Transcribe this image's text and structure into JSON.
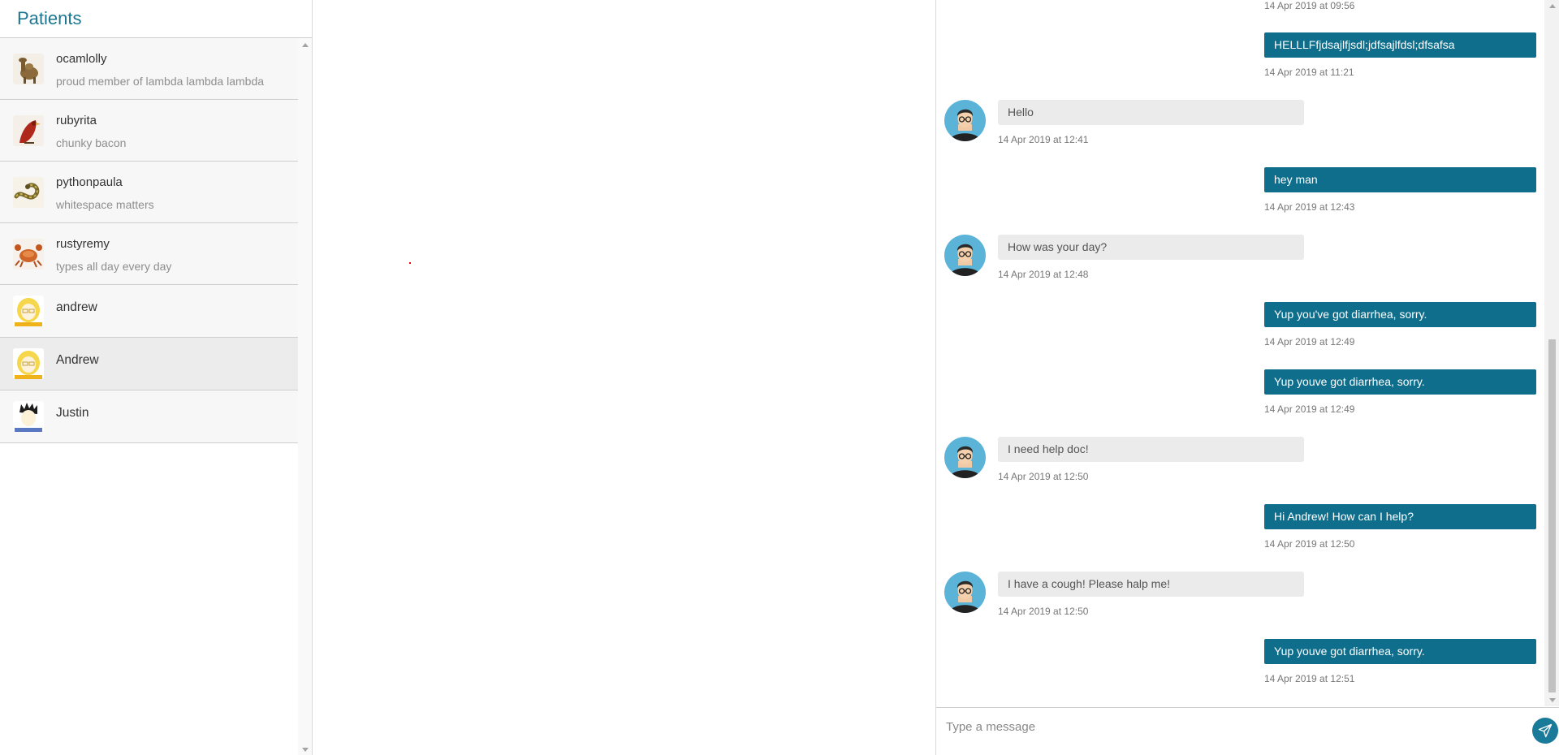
{
  "sidebar": {
    "title": "Patients",
    "patients": [
      {
        "name": "ocamlolly",
        "status": "proud member of lambda lambda lambda",
        "avatar": "camel-icon"
      },
      {
        "name": "rubyrita",
        "status": "chunky bacon",
        "avatar": "bird-icon"
      },
      {
        "name": "pythonpaula",
        "status": "whitespace matters",
        "avatar": "snake-icon"
      },
      {
        "name": "rustyremy",
        "status": "types all day every day",
        "avatar": "crab-icon"
      },
      {
        "name": "andrew",
        "status": "",
        "avatar": "blonde-user-icon"
      },
      {
        "name": "Andrew",
        "status": "",
        "avatar": "blonde-user-icon",
        "selected": true
      },
      {
        "name": "Justin",
        "status": "",
        "avatar": "dark-hair-user-icon"
      }
    ]
  },
  "chat": {
    "messages": [
      {
        "dir": "out",
        "text": "",
        "time": "14 Apr 2019 at 09:56"
      },
      {
        "dir": "out",
        "text": "HELLLFfjdsajlfjsdl;jdfsajlfdsl;dfsafsa",
        "time": "14 Apr 2019 at 11:21"
      },
      {
        "dir": "in",
        "text": "Hello",
        "time": "14 Apr 2019 at 12:41"
      },
      {
        "dir": "out",
        "text": "hey man",
        "time": "14 Apr 2019 at 12:43"
      },
      {
        "dir": "in",
        "text": "How was your day?",
        "time": "14 Apr 2019 at 12:48"
      },
      {
        "dir": "out",
        "text": "Yup you've got diarrhea, sorry.",
        "time": "14 Apr 2019 at 12:49"
      },
      {
        "dir": "out",
        "text": "Yup youve got diarrhea, sorry.",
        "time": "14 Apr 2019 at 12:49"
      },
      {
        "dir": "in",
        "text": "I need help doc!",
        "time": "14 Apr 2019 at 12:50"
      },
      {
        "dir": "out",
        "text": "Hi Andrew! How can I help?",
        "time": "14 Apr 2019 at 12:50"
      },
      {
        "dir": "in",
        "text": "I have a cough! Please halp me!",
        "time": "14 Apr 2019 at 12:50"
      },
      {
        "dir": "out",
        "text": "Yup youve got diarrhea, sorry.",
        "time": "14 Apr 2019 at 12:51"
      }
    ],
    "composer": {
      "placeholder": "Type a message",
      "send_icon": "paper-plane-icon"
    }
  },
  "colors": {
    "accent": "#0e6e8c",
    "title": "#1b7791",
    "incoming_bubble": "#ebebeb"
  }
}
